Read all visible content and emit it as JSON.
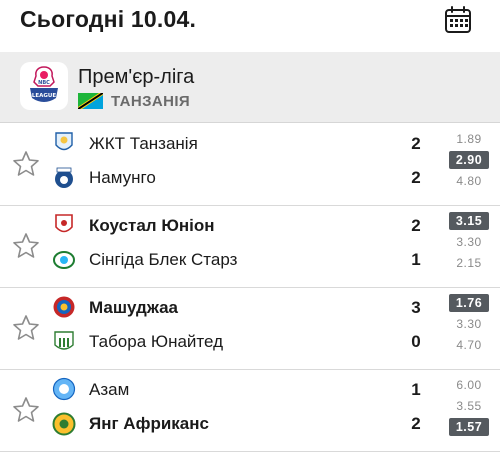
{
  "header": {
    "title": "Сьогодні 10.04."
  },
  "league": {
    "name": "Прем'єр-ліга",
    "country": "ТАНЗАНІЯ",
    "logo_text": "NBC PREMIER LEAGUE"
  },
  "matches": [
    {
      "home": {
        "name": "ЖКТ Танзанія",
        "score": "2",
        "bold": false
      },
      "away": {
        "name": "Намунго",
        "score": "2",
        "bold": false
      },
      "odds": [
        {
          "value": "1.89",
          "highlight": false
        },
        {
          "value": "2.90",
          "highlight": true
        },
        {
          "value": "4.80",
          "highlight": false
        }
      ]
    },
    {
      "home": {
        "name": "Коустал Юніон",
        "score": "2",
        "bold": true
      },
      "away": {
        "name": "Сінгіда Блек Старз",
        "score": "1",
        "bold": false
      },
      "odds": [
        {
          "value": "3.15",
          "highlight": true
        },
        {
          "value": "3.30",
          "highlight": false
        },
        {
          "value": "2.15",
          "highlight": false
        }
      ]
    },
    {
      "home": {
        "name": "Машуджаа",
        "score": "3",
        "bold": true
      },
      "away": {
        "name": "Табора Юнайтед",
        "score": "0",
        "bold": false
      },
      "odds": [
        {
          "value": "1.76",
          "highlight": true
        },
        {
          "value": "3.30",
          "highlight": false
        },
        {
          "value": "4.70",
          "highlight": false
        }
      ]
    },
    {
      "home": {
        "name": "Азам",
        "score": "1",
        "bold": false
      },
      "away": {
        "name": "Янг Африканс",
        "score": "2",
        "bold": true
      },
      "odds": [
        {
          "value": "6.00",
          "highlight": false
        },
        {
          "value": "3.55",
          "highlight": false
        },
        {
          "value": "1.57",
          "highlight": true
        }
      ]
    }
  ],
  "colors": {
    "league_bg": "#ededed",
    "odd_highlight_bg": "#555a5f",
    "odd_text": "#8a8a8a"
  }
}
